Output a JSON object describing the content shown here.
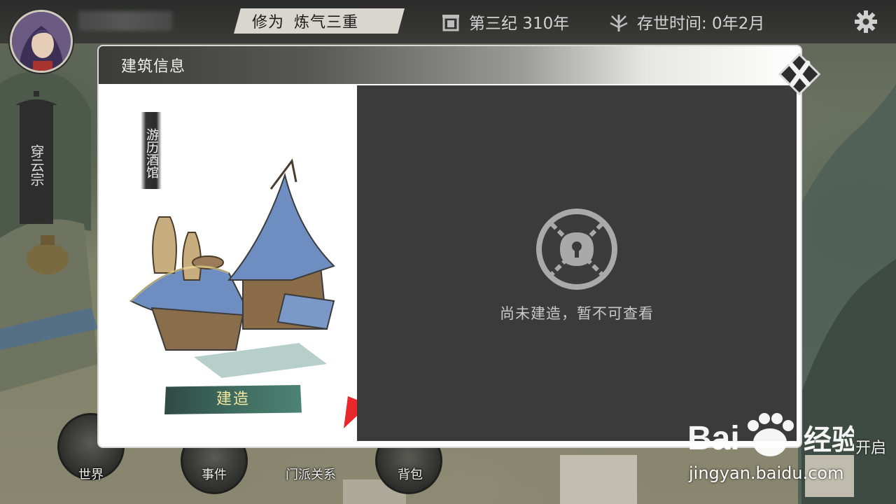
{
  "topbar": {
    "cultivation_label": "修为",
    "cultivation_value": "炼气三重",
    "era": "第三纪 310年",
    "lifetime": "存世时间: 0年2月"
  },
  "sidebar": {
    "sect_name": "穿云宗"
  },
  "nav": {
    "world": "世界",
    "events": "事件",
    "sect_relations": "门派关系",
    "bag": "背包"
  },
  "modal": {
    "title": "建筑信息",
    "building_name": "游历酒馆",
    "build_button": "建造",
    "locked_message": "尚未建造，暂不可查看"
  },
  "overlay": {
    "hint_fragment": "开启",
    "watermark_url": "jingyan.baidu.com"
  },
  "icons": {
    "settings": "gear-icon",
    "era": "calendar-gate-icon",
    "lifetime": "plant-sprout-icon",
    "close": "close-icon",
    "locked": "chained-lock-icon"
  },
  "colors": {
    "build_button": "#3f6b5f",
    "build_text": "#f3e9a0",
    "locked_pane": "#3b3b3b"
  }
}
